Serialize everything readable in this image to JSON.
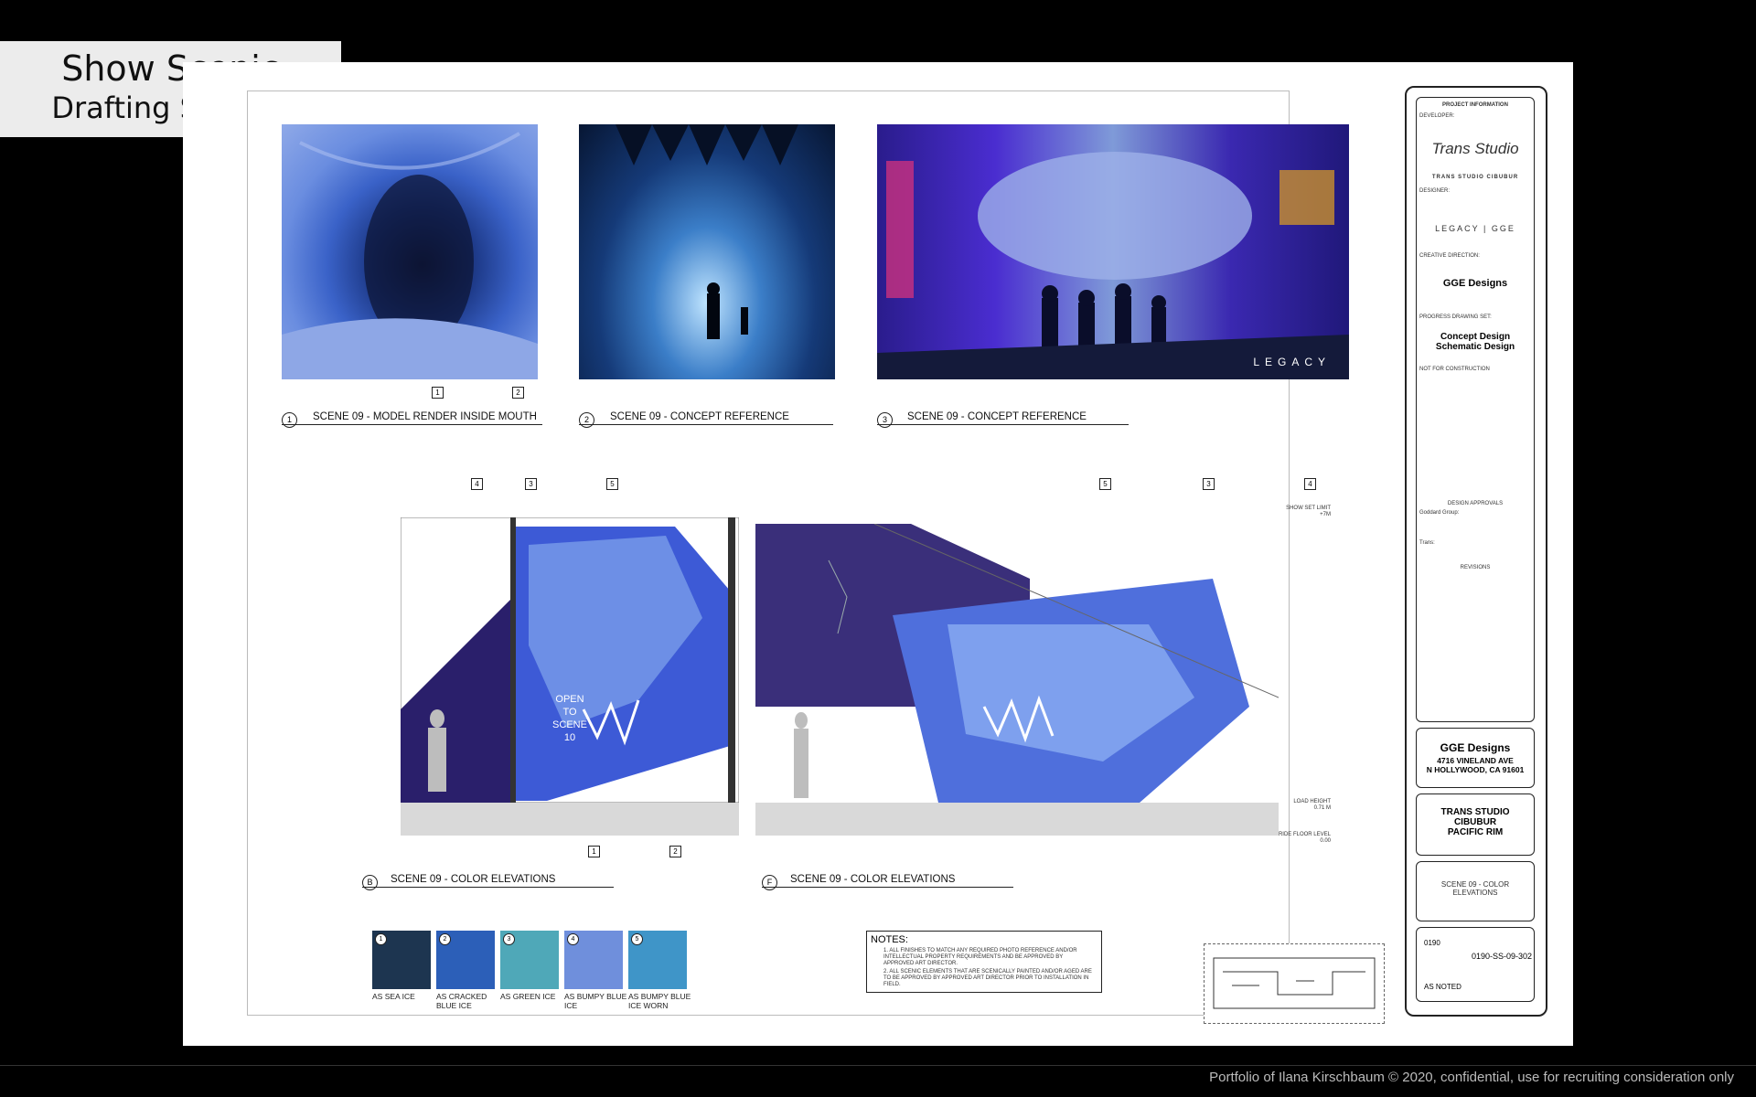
{
  "overlay_label": {
    "line1": "Show Scenic",
    "line2": "Drafting Sample"
  },
  "captions": [
    {
      "num": "1",
      "text": "SCENE 09 - MODEL RENDER INSIDE MOUTH"
    },
    {
      "num": "2",
      "text": "SCENE 09 - CONCEPT REFERENCE"
    },
    {
      "num": "3",
      "text": "SCENE 09 - CONCEPT REFERENCE"
    },
    {
      "num": "B",
      "text": "SCENE 09 - COLOR ELEVATIONS"
    },
    {
      "num": "F",
      "text": "SCENE 09 - COLOR ELEVATIONS"
    }
  ],
  "watermark": "LEGACY",
  "open_to_scene": [
    "OPEN",
    "TO",
    "SCENE",
    "10"
  ],
  "callouts": [
    "1",
    "2",
    "3",
    "4",
    "5"
  ],
  "levels": {
    "show_set_limit": "SHOW SET LIMIT",
    "show_set_value": "+7M",
    "load_height": "LOAD HEIGHT",
    "load_value": "0.71 M",
    "ride_floor": "RIDE FLOOR LEVEL",
    "ride_value": "0.00"
  },
  "swatches": [
    {
      "num": "1",
      "label": "AS SEA ICE",
      "color": "#1d3550"
    },
    {
      "num": "2",
      "label": "AS CRACKED BLUE ICE",
      "color": "#2c5fb8"
    },
    {
      "num": "3",
      "label": "AS GREEN ICE",
      "color": "#4fa8b8"
    },
    {
      "num": "4",
      "label": "AS BUMPY BLUE ICE",
      "color": "#6f8fdc"
    },
    {
      "num": "5",
      "label": "AS BUMPY BLUE ICE WORN",
      "color": "#3f95c8"
    }
  ],
  "notes": {
    "title": "NOTES:",
    "items": [
      "1.  ALL FINISHES TO MATCH ANY REQUIRED PHOTO REFERENCE AND/OR INTELLECTUAL PROPERTY REQUIREMENTS AND BE APPROVED BY APPROVED ART DIRECTOR.",
      "2.  ALL SCENIC ELEMENTS THAT ARE SCENICALLY PAINTED AND/OR AGED ARE TO BE APPROVED BY APPROVED ART DIRECTOR PRIOR TO INSTALLATION IN FIELD."
    ]
  },
  "title_block": {
    "project_information": "PROJECT INFORMATION",
    "developer_label": "DEVELOPER:",
    "developer_logo": "Trans Studio",
    "developer_name": "TRANS STUDIO CIBUBUR",
    "designer_label": "DESIGNER:",
    "designer_logo": "LEGACY | GGE",
    "creative_direction_label": "CREATIVE DIRECTION:",
    "creative_direction": "GGE Designs",
    "progress_label": "PROGRESS DRAWING SET:",
    "progress_1": "Concept Design",
    "progress_2": "Schematic Design",
    "not_for_construction": "NOT FOR CONSTRUCTION",
    "design_approvals": "DESIGN APPROVALS",
    "goddard_group": "Goddard Group:",
    "trans": "Trans:",
    "revisions": "REVISIONS",
    "firm_name": "GGE Designs",
    "firm_addr1": "4716 VINELAND AVE",
    "firm_addr2": "N HOLLYWOOD, CA 91601",
    "project_1": "TRANS STUDIO",
    "project_2": "CIBUBUR",
    "project_3": "PACIFIC RIM",
    "drawing_title_1": "SCENE 09 - COLOR",
    "drawing_title_2": "ELEVATIONS",
    "project_num": "0190",
    "drawing_num": "0190-SS-09-302",
    "scale": "AS NOTED"
  },
  "footer": "Portfolio of Ilana Kirschbaum © 2020, confidential, use for recruiting consideration only"
}
